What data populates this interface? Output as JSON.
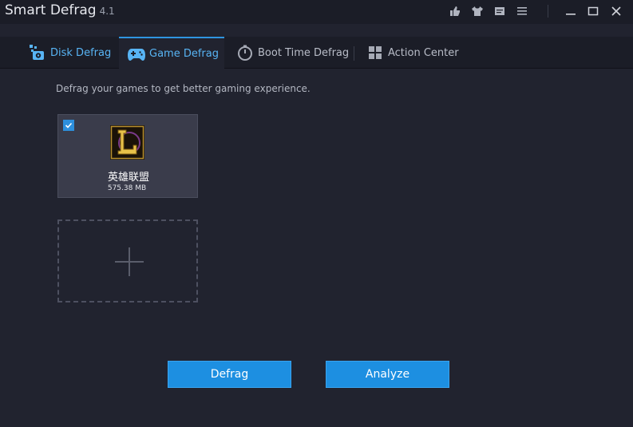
{
  "window": {
    "title": "Smart Defrag",
    "version": "4.1",
    "controls": [
      "like-icon",
      "skin-icon",
      "feedback-icon",
      "menu-icon",
      "minimize-icon",
      "maximize-icon",
      "close-icon"
    ]
  },
  "tabs": [
    {
      "label": "Disk Defrag",
      "icon": "disk-defrag-icon"
    },
    {
      "label": "Game Defrag",
      "icon": "gamepad-icon",
      "active": true
    },
    {
      "label": "Boot Time Defrag",
      "icon": "timer-icon"
    },
    {
      "label": "Action Center",
      "icon": "grid-icon"
    }
  ],
  "main": {
    "description": "Defrag your games to get better gaming experience.",
    "games": [
      {
        "name": "英雄联盟",
        "size": "575.38 MB",
        "checked": true,
        "icon": "league-of-legends-icon"
      }
    ],
    "add_game_icon": "plus-icon"
  },
  "buttons": {
    "defrag": "Defrag",
    "analyze": "Analyze"
  },
  "colors": {
    "accent": "#1d8fe1",
    "active_tab_text": "#58b4f4",
    "background": "#21232f",
    "titlebar": "#1b1d27"
  }
}
